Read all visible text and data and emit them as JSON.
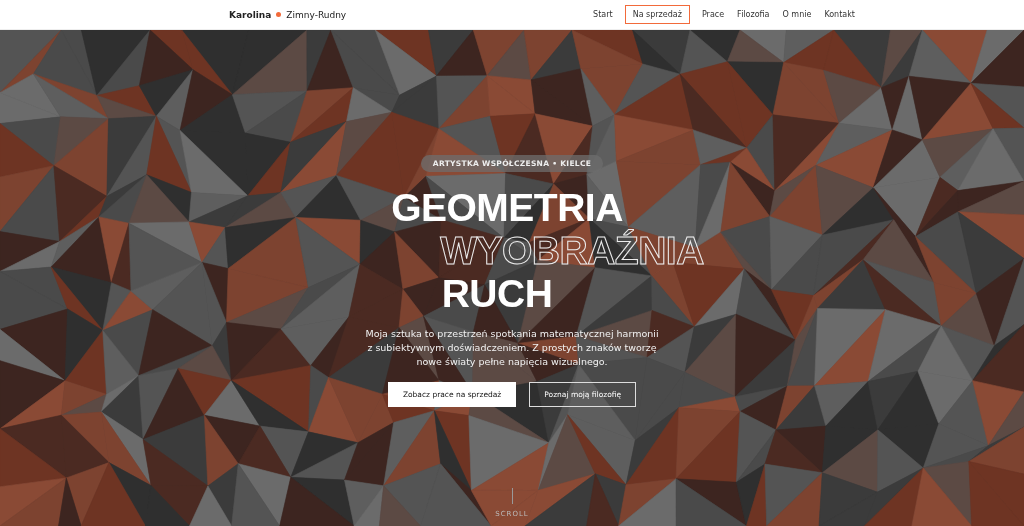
{
  "header": {
    "logo_first": "Karolina",
    "logo_last": "Zimny-Rudny",
    "nav": [
      {
        "label": "Start",
        "selected": false
      },
      {
        "label": "Na sprzedaż",
        "selected": true
      },
      {
        "label": "Prace",
        "selected": false
      },
      {
        "label": "Filozofia",
        "selected": false
      },
      {
        "label": "O mnie",
        "selected": false
      },
      {
        "label": "Kontakt",
        "selected": false
      }
    ]
  },
  "hero": {
    "badge": "ARTYSTKA WSPÓŁCZESNA • KIELCE",
    "title_lines": [
      {
        "text": "GEOMETRIA",
        "kind": "solid"
      },
      {
        "text": "WYOBRAŹNIA",
        "kind": "outline"
      },
      {
        "text": "RUCH",
        "kind": "solid"
      }
    ],
    "description": "Moja sztuka to przestrzeń spotkania matematycznej harmonii z subiektywnym doświadczeniem. Z prostych znaków tworzę nowe światy pełne napięcia wizualnego.",
    "buttons": [
      {
        "label": "Zobacz prace na sprzedaż",
        "kind": "primary"
      },
      {
        "label": "Poznaj moją filozofię",
        "kind": "secondary"
      }
    ],
    "scroll": "SCROLL"
  }
}
